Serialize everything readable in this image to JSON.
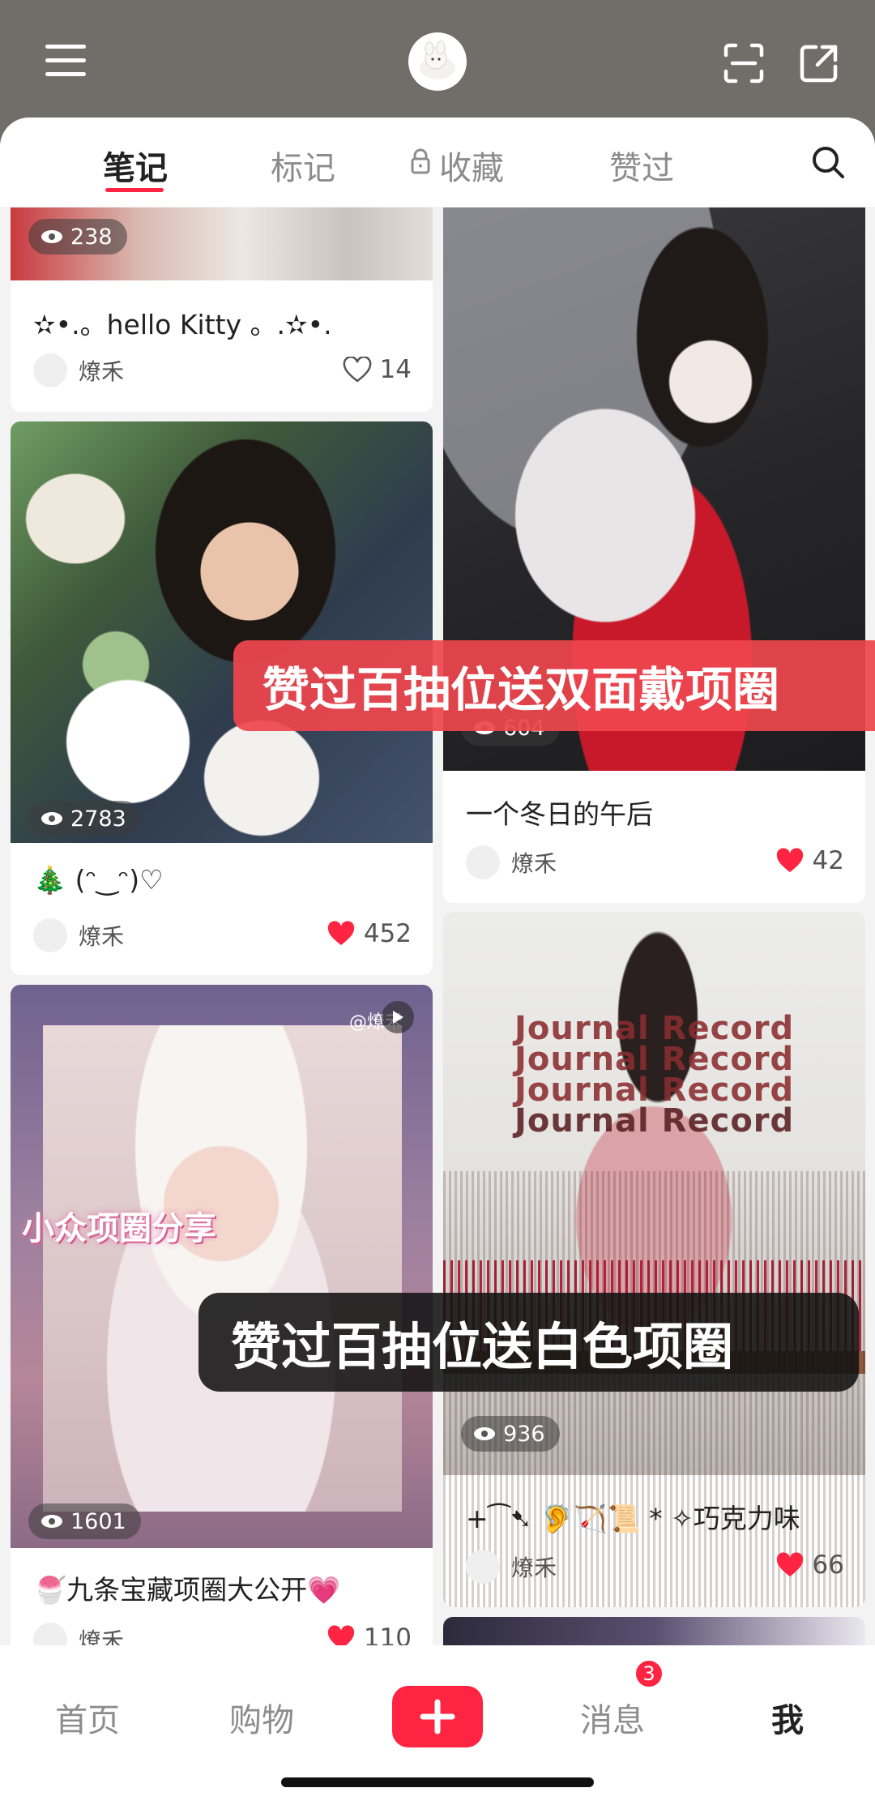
{
  "tabs": {
    "notes": "笔记",
    "marks": "标记",
    "favorites": "收藏",
    "liked": "赞过"
  },
  "cards": {
    "c1": {
      "views": "238",
      "title": "✫•.。hello Kitty 。.✫•.",
      "author": "燎禾",
      "likes": "14"
    },
    "c2": {
      "views": "2783",
      "title": "🎄 (ᵔ‿ᵔ)♡",
      "author": "燎禾",
      "likes": "452"
    },
    "c3": {
      "views": "1601",
      "title": "🍧九条宝藏项圈大公开💗",
      "author": "燎禾",
      "likes": "110",
      "image_caption": "小众项圈分享",
      "watermark": "@燎禾"
    },
    "c4": {
      "views": "604",
      "title": "一个冬日的午后",
      "author": "燎禾",
      "likes": "42"
    },
    "c5": {
      "views": "936",
      "title": "+⁀➷ 🦻🏹📜 * ✧巧克力味",
      "author": "燎禾",
      "likes": "66",
      "image_sign": "Journal Record"
    }
  },
  "banners": {
    "red": "赞过百抽位送双面戴项圈",
    "dark": "赞过百抽位送白色项圈"
  },
  "nav": {
    "home": "首页",
    "shop": "购物",
    "messages": "消息",
    "messages_badge": "3",
    "me": "我"
  },
  "colors": {
    "brand": "#ff2442",
    "header_bg": "#6f6e68"
  }
}
